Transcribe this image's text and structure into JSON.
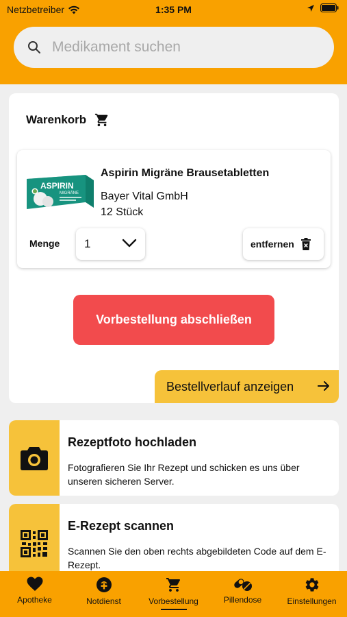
{
  "status_bar": {
    "carrier": "Netzbetreiber",
    "time": "1:35 PM"
  },
  "search": {
    "placeholder": "Medikament suchen"
  },
  "cart": {
    "title": "Warenkorb",
    "item": {
      "name": "Aspirin Migräne Brausetabletten",
      "manufacturer": "Bayer Vital GmbH",
      "package": "12 Stück",
      "quantity_label": "Menge",
      "quantity_value": "1",
      "remove_label": "entfernen",
      "image_brand": "ASPIRIN",
      "image_subbrand": "MIGRÄNE"
    },
    "order_button": "Vorbestellung abschließen",
    "history_button": "Bestellverlauf anzeigen"
  },
  "cards": [
    {
      "title": "Rezeptfoto hochladen",
      "description": "Fotografieren Sie Ihr Rezept und schicken es uns über unseren sicheren Server."
    },
    {
      "title": "E-Rezept scannen",
      "description": "Scannen Sie den oben rechts abgebildeten Code auf dem E-Rezept."
    }
  ],
  "tabs": [
    {
      "label": "Apotheke",
      "icon": "heart-icon"
    },
    {
      "label": "Notdienst",
      "icon": "emergency-icon"
    },
    {
      "label": "Vorbestellung",
      "icon": "cart-icon",
      "active": true
    },
    {
      "label": "Pillendose",
      "icon": "pills-icon"
    },
    {
      "label": "Einstellungen",
      "icon": "gear-icon"
    }
  ],
  "colors": {
    "header": "#f9a100",
    "accent_yellow": "#f6c23a",
    "order_red": "#f24b4d",
    "background": "#efefef"
  }
}
